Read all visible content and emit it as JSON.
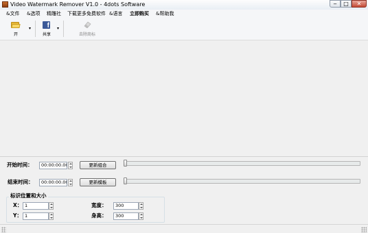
{
  "window": {
    "title": "Video Watermark Remover V1.0 - 4dots Software",
    "controls": {
      "minimize": "‒",
      "maximize": "□",
      "close": "✕"
    }
  },
  "menu": {
    "items": [
      {
        "label": "&文件",
        "bold": false
      },
      {
        "label": "&选项",
        "bold": false
      },
      {
        "label": "精雕社",
        "bold": false
      },
      {
        "label": "下载更多免费软件",
        "bold": false
      },
      {
        "label": "&语言",
        "bold": false
      },
      {
        "label": "立即购买",
        "bold": true
      },
      {
        "label": "&帮助我",
        "bold": false
      }
    ]
  },
  "toolbar": {
    "open_label": "开",
    "open_icon": "folder-icon",
    "share_label": "共享",
    "share_icon": "facebook-icon",
    "share_glyph": "f",
    "remove_label": "去除商标",
    "remove_icon": "eraser-icon",
    "dropdown_glyph": "▾"
  },
  "timing": {
    "start_label": "开始时间：",
    "start_value": "00:00:00.00",
    "start_button": "更新组合",
    "end_label": "结束时间：",
    "end_value": "00:00:00.00",
    "end_button": "更新模板"
  },
  "logo_position": {
    "group_title": "标识位置和大小",
    "x_label": "X：",
    "x_value": "1",
    "y_label": "Y：",
    "y_value": "1",
    "width_label": "宽度：",
    "width_value": "300",
    "height_label": "身高：",
    "height_value": "300"
  },
  "colors": {
    "facebook": "#3b5998",
    "folder": "#e8b838",
    "close_button": "#c44a35"
  }
}
